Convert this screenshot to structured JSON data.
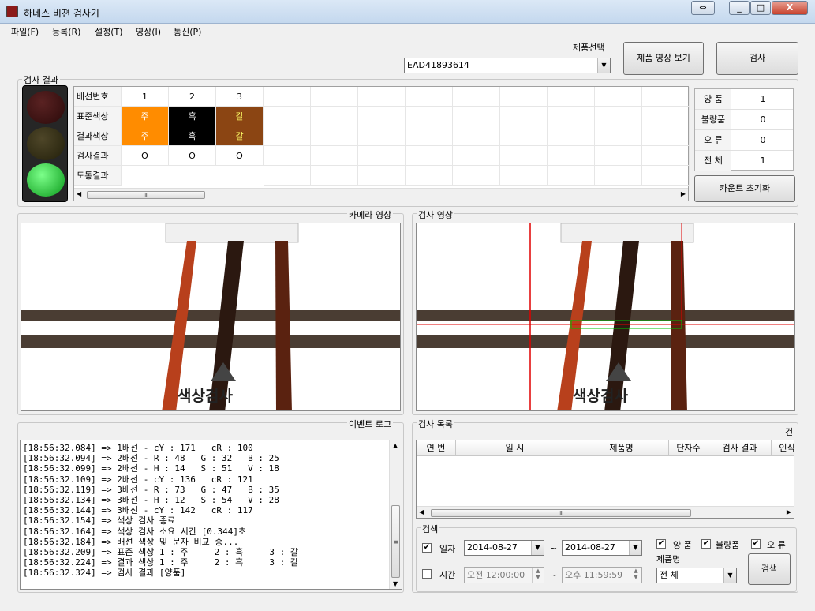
{
  "window": {
    "title": "하네스 비젼 검사기",
    "btn_min": "_",
    "btn_max": "□",
    "btn_close": "X",
    "btn_restore": "⇔"
  },
  "menu": [
    "파일(F)",
    "등록(R)",
    "설정(T)",
    "영상(I)",
    "통신(P)"
  ],
  "toolbar": {
    "product_label": "제품선택",
    "product_value": "EAD41893614",
    "view_btn": "제품 영상 보기",
    "inspect_btn": "검사"
  },
  "result": {
    "group_label": "검사 결과",
    "row_labels": [
      "배선번호",
      "표준색상",
      "결과색상",
      "검사결과",
      "도통결과"
    ],
    "columns": [
      {
        "no": "1",
        "std": "주",
        "res": "주",
        "check": "O",
        "std_color": "#ff8c00",
        "std_text_color": "#ffffff"
      },
      {
        "no": "2",
        "std": "흑",
        "res": "흑",
        "check": "O",
        "std_color": "#000000",
        "std_text_color": "#ffffff"
      },
      {
        "no": "3",
        "std": "갈",
        "res": "갈",
        "check": "O",
        "std_color": "#8b4513",
        "std_text_color": "#ffff66"
      }
    ],
    "scroll_thumb": "III"
  },
  "counts": {
    "rows": [
      {
        "k": "양  품",
        "v": "1"
      },
      {
        "k": "불량품",
        "v": "0"
      },
      {
        "k": "오  류",
        "v": "0"
      },
      {
        "k": "전  체",
        "v": "1"
      }
    ],
    "reset_btn": "카운트 초기화"
  },
  "camera": {
    "label": "카메라 영상",
    "overlay_text": "색상검사"
  },
  "inspect_view": {
    "label": "검사 영상",
    "overlay_text": "색상검사"
  },
  "log": {
    "label": "이벤트 로그",
    "lines": [
      "[18:56:32.084] => 1배선 - cY : 171   cR : 100",
      "[18:56:32.094] => 2배선 - R : 48   G : 32   B : 25",
      "[18:56:32.099] => 2배선 - H : 14   S : 51   V : 18",
      "[18:56:32.109] => 2배선 - cY : 136   cR : 121",
      "[18:56:32.119] => 3배선 - R : 73   G : 47   B : 35",
      "[18:56:32.134] => 3배선 - H : 12   S : 54   V : 28",
      "[18:56:32.144] => 3배선 - cY : 142   cR : 117",
      "[18:56:32.154] => 색상 검사 종료",
      "[18:56:32.164] => 색상 검사 소요 시간 [0.344]초",
      "[18:56:32.184] => 배선 색상 및 문자 비교 중...",
      "[18:56:32.209] => 표준 색상 1 : 주     2 : 흑     3 : 갈",
      "[18:56:32.224] => 결과 색상 1 : 주     2 : 흑     3 : 갈",
      "[18:56:32.324] => 검사 결과 [양품]"
    ]
  },
  "list": {
    "label": "검사 목록",
    "count_suffix": "건",
    "headers": [
      "연 번",
      "일 시",
      "제품명",
      "단자수",
      "검사 결과",
      "인식"
    ]
  },
  "search": {
    "label": "검색",
    "date_label": "일자",
    "date_from": "2014-08-27",
    "date_to": "2014-08-27",
    "tilde": "~",
    "time_label": "시간",
    "time_from": "오전 12:00:00",
    "time_to": "오후 11:59:59",
    "good_label": "양 품",
    "bad_label": "불량품",
    "err_label": "오 류",
    "product_label": "제품명",
    "product_value": "전      체",
    "search_btn": "검색",
    "check_mark": "✔"
  }
}
